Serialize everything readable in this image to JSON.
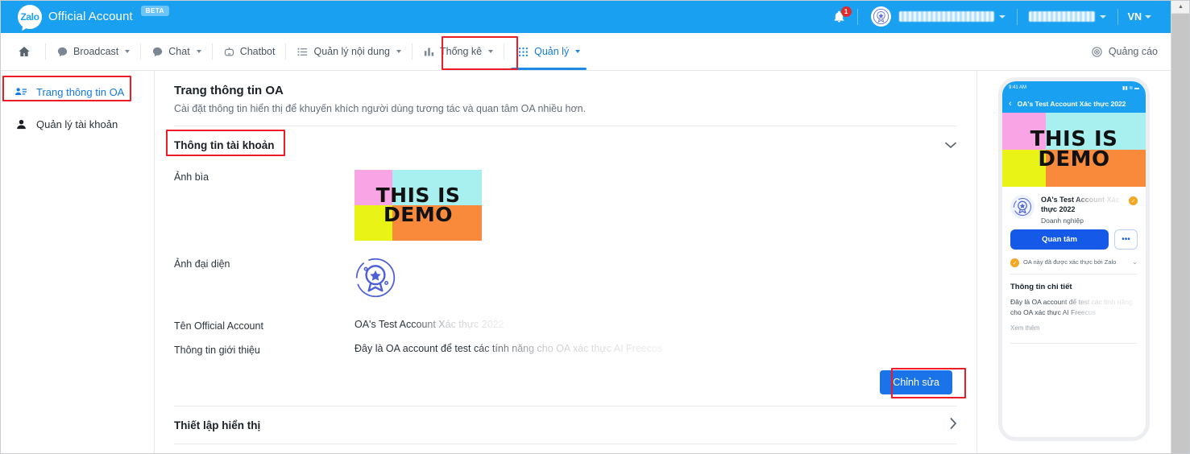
{
  "header": {
    "brand_name": "Official Account",
    "logo_text": "Zalo",
    "beta_label": "BETA",
    "notification_count": "1",
    "language": "VN"
  },
  "nav": {
    "items": [
      {
        "label": "",
        "icon": "home-icon",
        "caret": false,
        "active": false
      },
      {
        "label": "Broadcast",
        "icon": "broadcast-icon",
        "caret": true,
        "active": false
      },
      {
        "label": "Chat",
        "icon": "chat-icon",
        "caret": true,
        "active": false
      },
      {
        "label": "Chatbot",
        "icon": "chatbot-icon",
        "caret": false,
        "active": false
      },
      {
        "label": "Quản lý nội dung",
        "icon": "content-list-icon",
        "caret": true,
        "active": false
      },
      {
        "label": "Thống kê",
        "icon": "bar-chart-icon",
        "caret": true,
        "active": false
      },
      {
        "label": "Quản lý",
        "icon": "grid-icon",
        "caret": true,
        "active": true
      }
    ],
    "ads_label": "Quảng cáo"
  },
  "sidebar": {
    "items": [
      {
        "label": "Trang thông tin OA",
        "icon": "profile-card-icon",
        "active": true
      },
      {
        "label": "Quản lý tài khoản",
        "icon": "user-icon",
        "active": false
      }
    ]
  },
  "main": {
    "page_title": "Trang thông tin OA",
    "page_subtitle": "Cài đặt thông tin hiển thị để khuyến khích người dùng tương tác và quan tâm OA nhiều hơn.",
    "account_section_title": "Thông tin tài khoản",
    "fields": {
      "cover_label": "Ảnh bìa",
      "avatar_label": "Ảnh đại diện",
      "name_label": "Tên Official Account",
      "name_value": "OA's Test Account Xác thực 2022",
      "desc_label": "Thông tin giới thiệu",
      "desc_value": "Đây là OA account để test các tính năng cho OA xác thực AI Freecos"
    },
    "cover_text": {
      "line1": "THIS IS",
      "line2": "DEMO"
    },
    "edit_button": "Chỉnh sửa",
    "display_section_title": "Thiết lập hiển thị"
  },
  "preview": {
    "status_time": "9:41 AM",
    "nav_title": "OA's Test Account Xác thực 2022",
    "cover_text": {
      "line1": "THIS IS",
      "line2": "DEMO"
    },
    "account_name": "OA's Test Account Xác thực 2022",
    "account_type": "Doanh nghiệp",
    "follow_button": "Quan tâm",
    "more_button": "•••",
    "verified_text": "OA này đã được xác thực bởi Zalo",
    "detail_title": "Thông tin chi tiết",
    "detail_body": "Đây là OA account để test các tính năng cho OA xác thực AI Freecos",
    "see_more": "Xem thêm"
  },
  "colors": {
    "brand_blue": "#1aa0f0",
    "accent_blue": "#1a73e8",
    "highlight_red": "#ee1c25",
    "cover_pink": "#f9a4e4",
    "cover_cyan": "#a8f0ef",
    "cover_yellow": "#e9f316",
    "cover_orange": "#f98a3c"
  }
}
